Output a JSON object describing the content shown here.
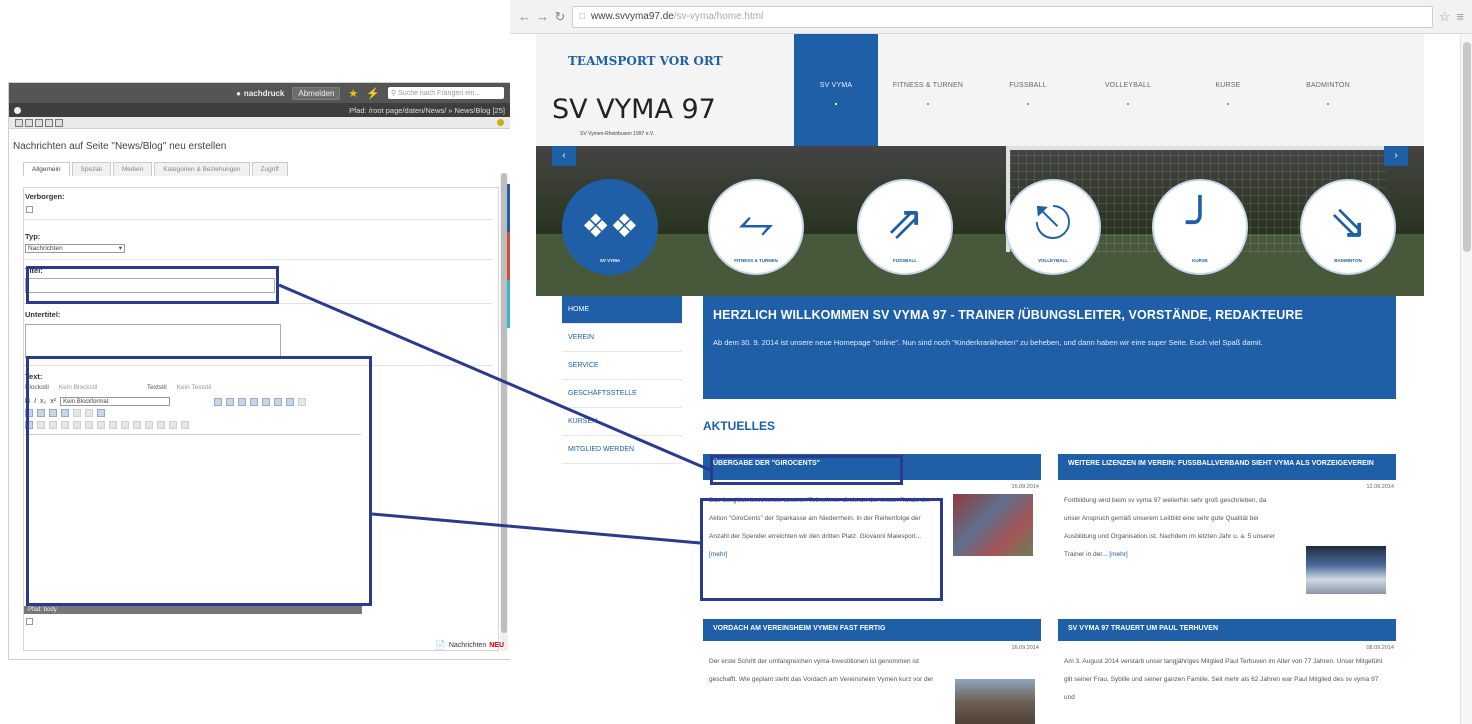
{
  "cms": {
    "user": "nachdruck",
    "logout": "Abmelden",
    "search_placeholder": "Suche nach Frangen ein...",
    "path": "Pfad: /root page/daten/News/ » News/Blog [25]",
    "heading": "Nachrichten auf Seite \"News/Blog\" neu erstellen",
    "tabs": [
      "Allgemein",
      "Spezial",
      "Medien",
      "Kategorien & Beziehungen",
      "Zugriff"
    ],
    "fields": {
      "hidden_label": "Verborgen:",
      "type_label": "Typ:",
      "type_value": "Nachrichten",
      "title_label": "Titel:",
      "subtitle_label": "Untertitel:",
      "text_label": "Text:",
      "block_style_label": "Blockstil",
      "block_style_value": "Kein Blockstil",
      "text_style_label": "Textstil",
      "text_style_value": "Kein Textstil",
      "paragraph_format": "Kein Blockformat"
    },
    "statusbar": "Pfad: body",
    "footer_link": "Nachrichten",
    "footer_badge": "NEU"
  },
  "browser": {
    "url_domain": "www.svvyma97.de",
    "url_path": "/sv-vyma/home.html"
  },
  "site": {
    "logo_arc": "TEAMSPORT VOR ORT",
    "logo_name": "SV VYMA 97",
    "logo_sub": "SV Vymen-Rheinbusen 1997 e.V.",
    "nav": [
      "SV VYMA",
      "FITNESS & TURNEN",
      "FUSSBALL",
      "VOLLEYBALL",
      "KURSE",
      "BADMINTON"
    ],
    "circles": [
      "SV VYMA",
      "FITNESS & TURNEN",
      "FUSSBALL",
      "VOLLEYBALL",
      "KURSE",
      "BADMINTON"
    ],
    "sidenav": [
      "HOME",
      "VEREIN",
      "SERVICE",
      "GESCHÄFTSSTELLE",
      "KURSEN",
      "MITGLIED WERDEN"
    ],
    "welcome_title": "HERZLICH WILLKOMMEN SV VYMA 97 - TRAINER /ÜBUNGSLEITER, VORSTÄNDE, REDAKTEURE",
    "welcome_body": "Ab dem 30. 9. 2014 ist unsere neue Homepage \"online\". Nun sind noch \"Kinderkrankheiten\" zu beheben, und dann haben wir eine super Seite. Euch viel Spaß damit.",
    "aktuelles": "AKTUELLES",
    "more": "[mehr]",
    "cards": [
      {
        "title": "ÜBERGABE DER \"GIROCENTS\"",
        "date": "16.09.2014",
        "body": "Das Losglück beschertes unseren Teilnehmer direkt an der ersten Runde der Aktion \"GiroCents\" der Sparkasse am Niederrhein. In der Reihenfolge der Anzahl der Spender erreichten wir den dritten Platz. Giovanni Maiesport..."
      },
      {
        "title": "WEITERE LIZENZEN IM VEREIN: FUSSBALLVERBAND SIEHT VYMA ALS VORZEIGEVEREIN",
        "date": "12.09.2014",
        "body": "Fortbildung wird beim sv vyma 97 weiterhin sehr groß geschrieben, da unser Anspruch gemäß unserem Leitbild eine sehr gute Qualität bei Ausbildung und Organisation ist. Nachdem im letzten Jahr u. a. 5 unserer Trainer in der..."
      },
      {
        "title": "VORDACH AM VEREINSHEIM VYMEN FAST FERTIG",
        "date": "16.09.2014",
        "body": "Der erste Schritt der umfangreichen vyma-Investitionen ist genommen ist geschafft. Wie geplant steht das Vordach am Vereinsheim Vymen kurz vor der"
      },
      {
        "title": "SV VYMA 97 TRAUERT UM PAUL TERHUVEN",
        "date": "08.09.2014",
        "body": "Am 3. August 2014 verstarb unser langjähriges Mitglied Paul Terhuven im Alter von 77 Jahren. Unser Mitgefühl gilt seiner Frau, Sybille und seiner ganzen Familie. Seit mehr als 62 Jahren war Paul Mitglied des sv vyma 97 und"
      }
    ]
  }
}
